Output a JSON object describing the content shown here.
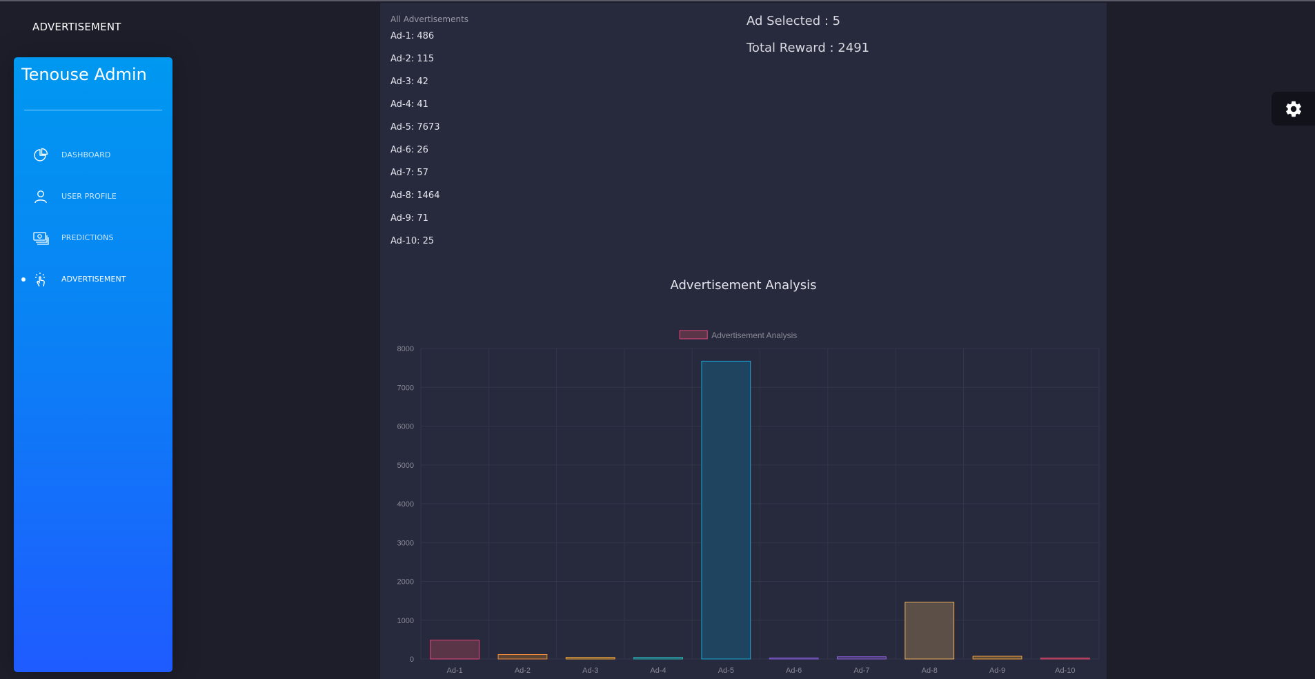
{
  "header": {
    "title": "ADVERTISEMENT"
  },
  "sidebar": {
    "logo": "Tenouse Admin",
    "items": [
      {
        "label": "DASHBOARD",
        "icon": "chart-pie-icon",
        "active": false
      },
      {
        "label": "USER PROFILE",
        "icon": "user-icon",
        "active": false
      },
      {
        "label": "PREDICTIONS",
        "icon": "money-icon",
        "active": false
      },
      {
        "label": "ADVERTISEMENT",
        "icon": "tap-icon",
        "active": true
      }
    ]
  },
  "ads": {
    "heading": "All Advertisements",
    "items": [
      "Ad-1: 486",
      "Ad-2: 115",
      "Ad-3: 42",
      "Ad-4: 41",
      "Ad-5: 7673",
      "Ad-6: 26",
      "Ad-7: 57",
      "Ad-8: 1464",
      "Ad-9: 71",
      "Ad-10: 25"
    ]
  },
  "stats": {
    "ad_selected": "Ad Selected : 5",
    "total_reward": "Total Reward : 2491"
  },
  "chart_title": "Advertisement Analysis",
  "settings": {
    "icon": "gear-icon"
  },
  "colors": {
    "sidebar_top": "#0098f0",
    "sidebar_bottom": "#1f5bff",
    "panel": "#27293d",
    "background": "#1e1e2b"
  },
  "chart_data": {
    "type": "bar",
    "categories": [
      "Ad-1",
      "Ad-2",
      "Ad-3",
      "Ad-4",
      "Ad-5",
      "Ad-6",
      "Ad-7",
      "Ad-8",
      "Ad-9",
      "Ad-10"
    ],
    "series": [
      {
        "name": "Advertisement Analysis",
        "values": [
          486,
          115,
          42,
          41,
          7673,
          26,
          57,
          1464,
          71,
          25
        ]
      }
    ],
    "ylim": [
      0,
      8000
    ],
    "yticks": [
      0,
      1000,
      2000,
      3000,
      4000,
      5000,
      6000,
      7000,
      8000
    ],
    "grid": true,
    "legend": "top-center",
    "bar_colors": [
      {
        "fill": "#5a3447",
        "stroke": "#e3487a"
      },
      {
        "fill": "#5b4433",
        "stroke": "#f08c3c"
      },
      {
        "fill": "#5a4a36",
        "stroke": "#f2a83c"
      },
      {
        "fill": "#2a4a52",
        "stroke": "#2ab5c0"
      },
      {
        "fill": "#1f4460",
        "stroke": "#19a7d8"
      },
      {
        "fill": "#3a3358",
        "stroke": "#8a5de0"
      },
      {
        "fill": "#3b3458",
        "stroke": "#9064e6"
      },
      {
        "fill": "#5b4f48",
        "stroke": "#f0b25a"
      },
      {
        "fill": "#5a4a38",
        "stroke": "#f0a040"
      },
      {
        "fill": "#553040",
        "stroke": "#e04a70"
      }
    ],
    "legend_color": {
      "fill": "#5a3447",
      "stroke": "#e3487a"
    },
    "axis_text_color": "#8a8a96",
    "grid_color": "#33354a"
  }
}
